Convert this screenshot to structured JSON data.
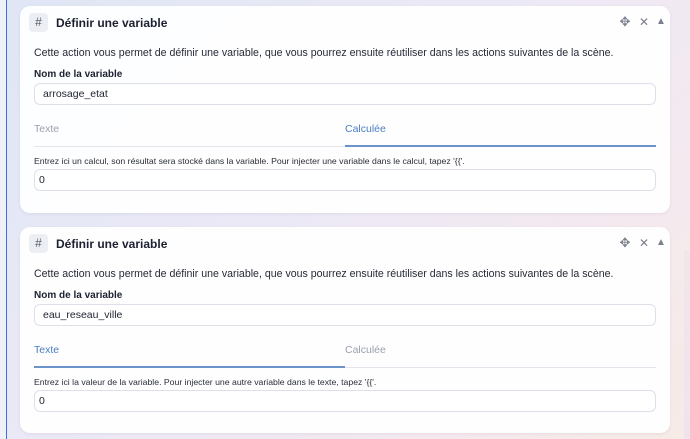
{
  "cards": [
    {
      "badge": "#",
      "title": "Définir une variable",
      "icons": {
        "move": "move-icon",
        "close": "close-icon",
        "collapse": "chevron-up-icon"
      },
      "description": "Cette action vous permet de définir une variable, que vous pourrez ensuite réutiliser dans les actions suivantes de la scène.",
      "name_label": "Nom de la variable",
      "name_value": "arrosage_etat",
      "tabs": [
        "Texte",
        "Calculée"
      ],
      "active_tab": "Calculée",
      "hint": "Entrez ici un calcul, son résultat sera stocké dans la variable. Pour injecter une variable dans le calcul, tapez '{{'.",
      "value": "0"
    },
    {
      "badge": "#",
      "title": "Définir une variable",
      "icons": {
        "move": "move-icon",
        "close": "close-icon",
        "collapse": "chevron-up-icon"
      },
      "description": "Cette action vous permet de définir une variable, que vous pourrez ensuite réutiliser dans les actions suivantes de la scène.",
      "name_label": "Nom de la variable",
      "name_value": "eau_reseau_ville",
      "tabs": [
        "Texte",
        "Calculée"
      ],
      "active_tab": "Texte",
      "hint": "Entrez ici la valeur de la variable. Pour injecter une autre variable dans le texte, tapez '{{'.",
      "value": "0"
    }
  ],
  "colors": {
    "accent": "#4a7dc0",
    "rail": "#3f6fd8"
  }
}
